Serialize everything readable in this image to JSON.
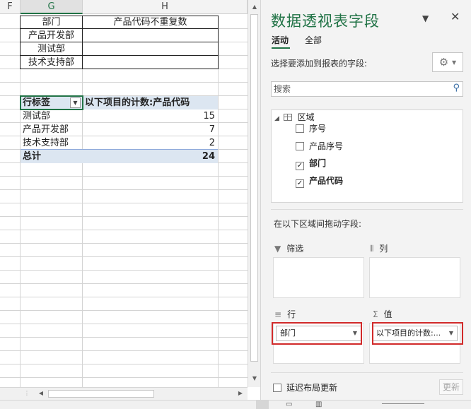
{
  "sheet": {
    "columns": [
      "F",
      "G",
      "H"
    ],
    "source_table": {
      "header": [
        "部门",
        "产品代码不重复数"
      ],
      "rows": [
        [
          "产品开发部",
          ""
        ],
        [
          "测试部",
          ""
        ],
        [
          "技术支持部",
          ""
        ]
      ]
    },
    "pivot": {
      "row_label_header": "行标签",
      "value_header": "以下项目的计数:产品代码",
      "rows": [
        {
          "label": "测试部",
          "value": "15"
        },
        {
          "label": "产品开发部",
          "value": "7"
        },
        {
          "label": "技术支持部",
          "value": "2"
        }
      ],
      "total_label": "总计",
      "total_value": "24"
    }
  },
  "panel": {
    "title": "数据透视表字段",
    "tabs": [
      "活动",
      "全部"
    ],
    "choose_label": "选择要添加到报表的字段:",
    "search_placeholder": "搜索",
    "tree_root": "区域",
    "fields": [
      {
        "name": "序号",
        "checked": false
      },
      {
        "name": "产品序号",
        "checked": false
      },
      {
        "name": "部门",
        "checked": true
      },
      {
        "name": "产品代码",
        "checked": true
      }
    ],
    "drag_label": "在以下区域间拖动字段:",
    "areas": {
      "filter": "筛选",
      "columns": "列",
      "rows": "行",
      "values": "值"
    },
    "row_field": "部门",
    "value_field": "以下项目的计数:...",
    "defer_label": "延迟布局更新",
    "update_label": "更新"
  },
  "colors": {
    "accent": "#217346",
    "pivot_header_bg": "#dce6f1",
    "highlight": "#d12a2a"
  }
}
